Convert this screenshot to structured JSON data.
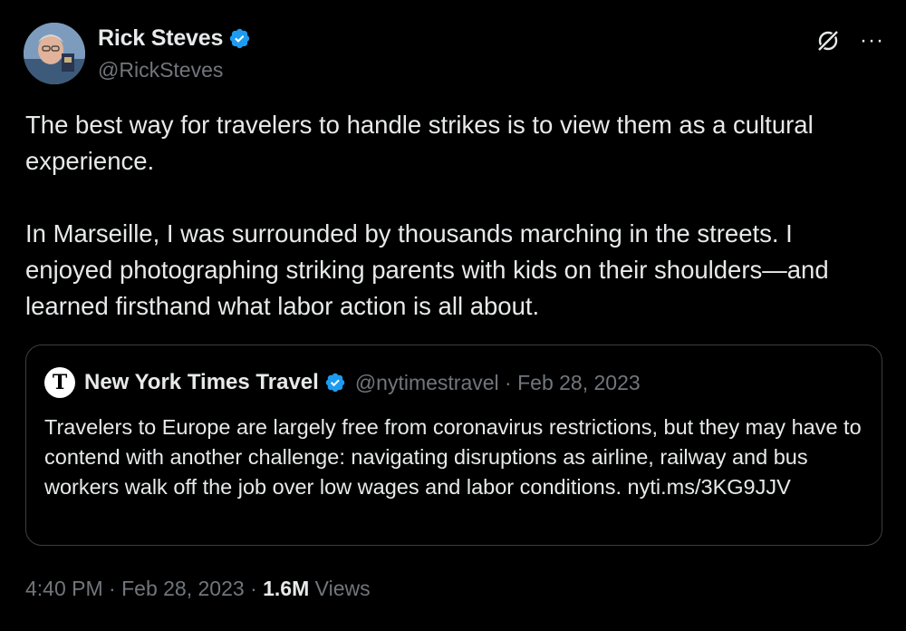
{
  "author": {
    "display_name": "Rick Steves",
    "handle": "@RickSteves",
    "verified": true
  },
  "tweet": {
    "paragraphs": [
      "The best way for travelers to handle strikes is to view them as a cultural experience.",
      "In Marseille, I was surrounded by thousands marching in the streets. I enjoyed photographing striking parents with kids on their shoulders—and learned firsthand what labor action is all about."
    ]
  },
  "quoted_tweet": {
    "display_name": "New York Times Travel",
    "handle": "@nytimestravel",
    "separator": "·",
    "date": "Feb 28, 2023",
    "logo_glyph": "T",
    "text": "Travelers to Europe are largely free from coronavirus restrictions, but they may have to contend with another challenge: navigating disruptions as airline, railway and bus workers walk off the job over low wages and labor conditions. nyti.ms/3KG9JJV"
  },
  "footer": {
    "time": "4:40 PM",
    "date": "Feb 28, 2023",
    "views_count": "1.6M",
    "views_label": "Views",
    "separator": "·"
  },
  "icons": {
    "grok": "grok-icon",
    "more": "···"
  },
  "colors": {
    "background": "#000000",
    "text_primary": "#e7e9ea",
    "text_secondary": "#71767b",
    "verified_blue": "#1d9bf0",
    "border": "#3a3f44"
  }
}
